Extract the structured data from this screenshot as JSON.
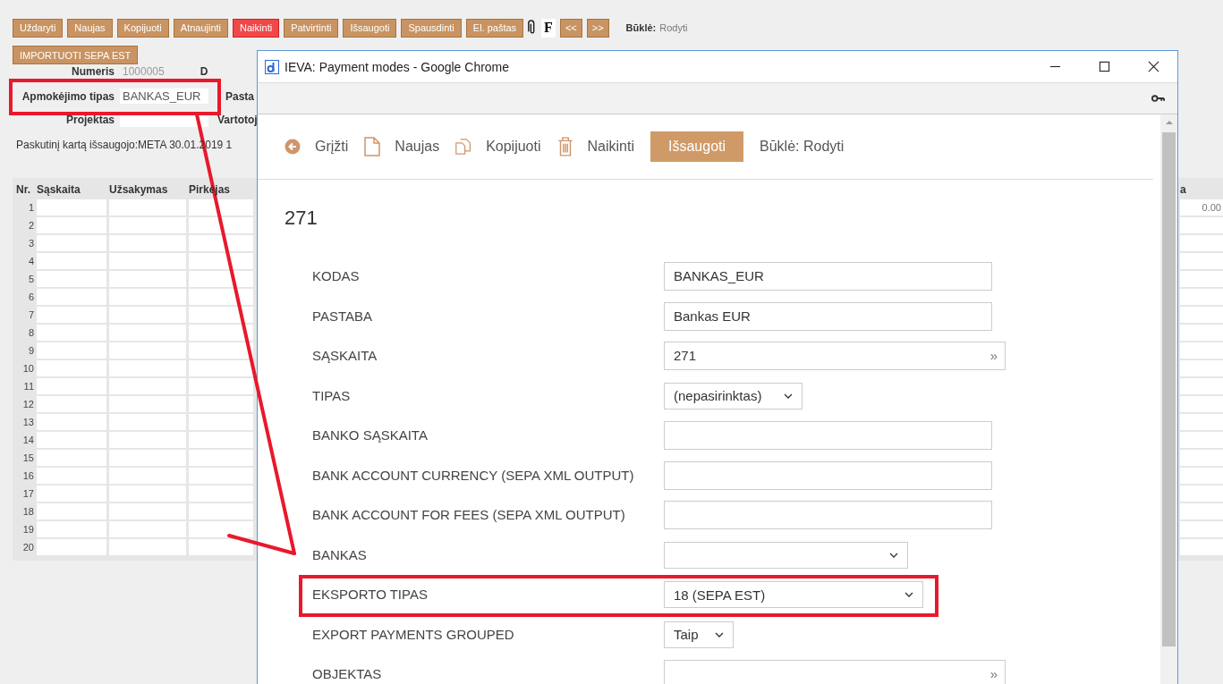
{
  "toolbar": {
    "buttons": [
      {
        "label": "Uždaryti",
        "kind": "normal"
      },
      {
        "label": "Naujas",
        "kind": "normal"
      },
      {
        "label": "Kopijuoti",
        "kind": "normal"
      },
      {
        "label": "Atnaujinti",
        "kind": "normal"
      },
      {
        "label": "Naikinti",
        "kind": "danger"
      },
      {
        "label": "Patvirtinti",
        "kind": "normal"
      },
      {
        "label": "Išsaugoti",
        "kind": "normal"
      },
      {
        "label": "Spausdinti",
        "kind": "normal"
      },
      {
        "label": "El. paštas",
        "kind": "normal"
      }
    ],
    "font_button": "F",
    "prev": "<<",
    "next": ">>",
    "status_label": "Būklė:",
    "status_value": "Rodyti"
  },
  "import_button": "IMPORTUOTI SEPA EST",
  "header_fields": [
    {
      "label": "Numeris",
      "value": "1000005",
      "cut_label": "D"
    },
    {
      "label": "Apmokėjimo tipas",
      "value": "BANKAS_EUR",
      "cut_label": "Pasta"
    },
    {
      "label": "Projektas",
      "cut_label": "Vartotoj"
    }
  ],
  "last_saved": "Paskutinį kartą išsaugojo:META 30.01.2019 1",
  "table": {
    "columns": [
      "Nr.",
      "Sąskaita",
      "Užsakymas",
      "Pirkėjas",
      "a"
    ],
    "rows": [
      {
        "number": "1",
        "column_5": "0.00"
      },
      {
        "number": "2"
      },
      {
        "number": "3"
      },
      {
        "number": "4"
      },
      {
        "number": "5"
      },
      {
        "number": "6"
      },
      {
        "number": "7"
      },
      {
        "number": "8"
      },
      {
        "number": "9"
      },
      {
        "number": "10"
      },
      {
        "number": "11"
      },
      {
        "number": "12"
      },
      {
        "number": "13"
      },
      {
        "number": "14"
      },
      {
        "number": "15"
      },
      {
        "number": "16"
      },
      {
        "number": "17"
      },
      {
        "number": "18"
      },
      {
        "number": "19"
      },
      {
        "number": "20"
      }
    ]
  },
  "popup": {
    "window_title": "IEVA: Payment modes - Google Chrome",
    "toolbar": [
      {
        "label": "Grįžti",
        "kind": "back"
      },
      {
        "label": "Naujas",
        "kind": "new"
      },
      {
        "label": "Kopijuoti",
        "kind": "copy"
      },
      {
        "label": "Naikinti",
        "kind": "delete"
      },
      {
        "label": "Išsaugoti",
        "kind": "save"
      }
    ],
    "status": "Būklė: Rodyti",
    "record_title": "271",
    "fields": [
      {
        "label": "KODAS",
        "kind": "input",
        "value": "BANKAS_EUR"
      },
      {
        "label": "PASTABA",
        "kind": "input",
        "value": "Bankas EUR"
      },
      {
        "label": "SĄSKAITA",
        "kind": "lookup",
        "value": "271",
        "button": "»"
      },
      {
        "label": "TIPAS",
        "kind": "select",
        "value": "(nepasirinktas)"
      },
      {
        "label": "BANKO SĄSKAITA",
        "kind": "input"
      },
      {
        "label": "BANK ACCOUNT CURRENCY (SEPA XML OUTPUT)",
        "kind": "input"
      },
      {
        "label": "BANK ACCOUNT FOR FEES (SEPA XML OUTPUT)",
        "kind": "input"
      },
      {
        "label": "BANKAS",
        "kind": "select"
      },
      {
        "label": "EKSPORTO TIPAS",
        "kind": "select",
        "value": "18 (SEPA EST)"
      },
      {
        "label": "EXPORT PAYMENTS GROUPED",
        "kind": "select",
        "value": "Taip"
      },
      {
        "label": "OBJEKTAS",
        "kind": "lookup",
        "button": "»"
      }
    ]
  }
}
